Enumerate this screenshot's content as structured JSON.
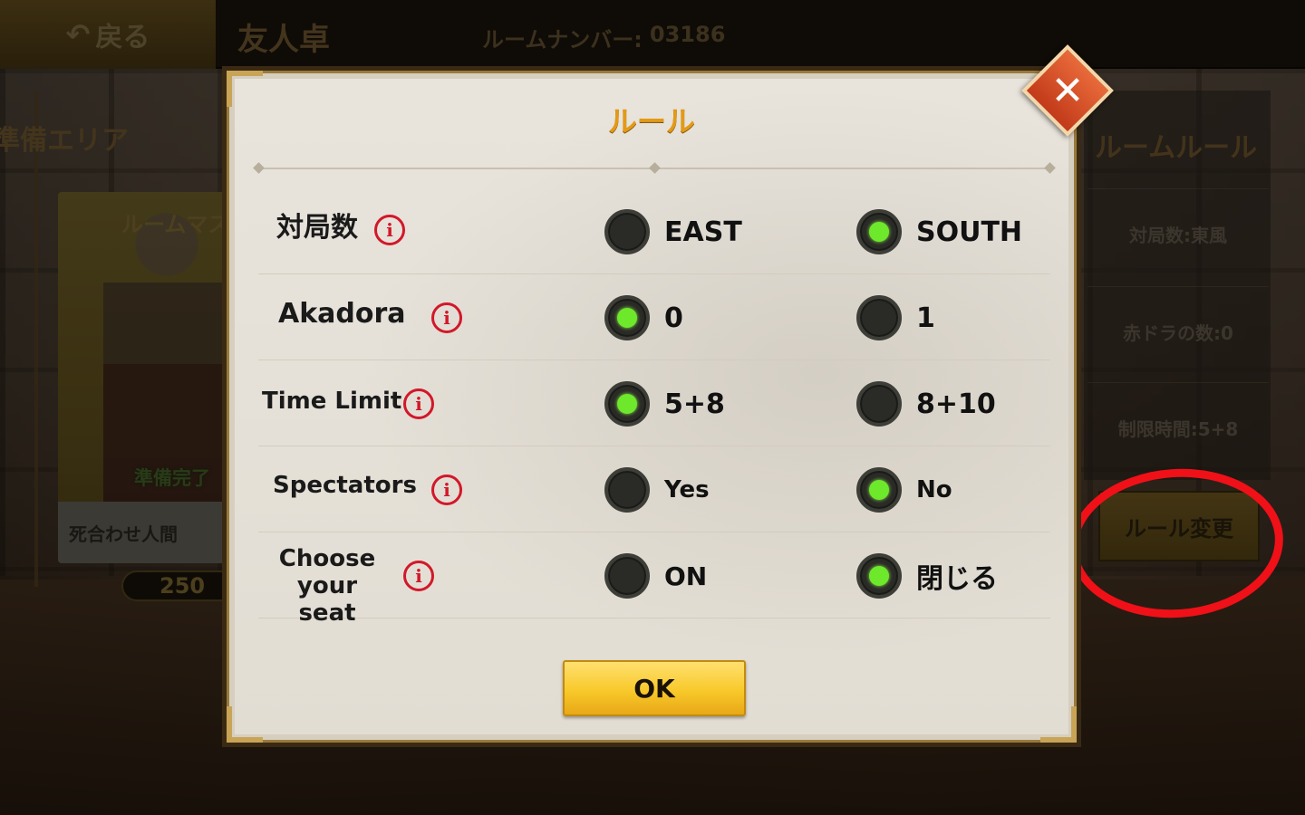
{
  "topbar": {
    "back_label": "戻る",
    "title": "友人卓",
    "room_number_label": "ルームナンバー:",
    "room_number": "03186"
  },
  "left_panel": {
    "area_title": "準備エリア",
    "card_title": "ルームマス",
    "ready_badge": "準備完了",
    "player_name": "死合わせ人間",
    "score": "250"
  },
  "right_panel": {
    "title": "ルームルール",
    "rows": [
      "対局数:東風",
      "赤ドラの数:0",
      "制限時間:5+8"
    ],
    "change_button": "ルール変更"
  },
  "modal": {
    "title": "ルール",
    "close_icon": "close-x-icon",
    "ok_label": "OK",
    "rules": [
      {
        "label": "対局数",
        "options": [
          {
            "label": "EAST",
            "selected": false
          },
          {
            "label": "SOUTH",
            "selected": true
          }
        ]
      },
      {
        "label": "Akadora",
        "options": [
          {
            "label": "0",
            "selected": true
          },
          {
            "label": "1",
            "selected": false
          }
        ]
      },
      {
        "label": "Time Limit",
        "options": [
          {
            "label": "5+8",
            "selected": true
          },
          {
            "label": "8+10",
            "selected": false
          }
        ]
      },
      {
        "label": "Spectators",
        "options": [
          {
            "label": "Yes",
            "selected": false
          },
          {
            "label": "No",
            "selected": true
          }
        ]
      },
      {
        "label_line1": "Choose",
        "label_line2": "your seat",
        "options": [
          {
            "label": "ON",
            "selected": false
          },
          {
            "label": "閉じる",
            "selected": true
          }
        ]
      }
    ]
  },
  "colors": {
    "accent_gold": "#e39a16",
    "radio_selected": "#6ee82a",
    "info_red": "#d2182a",
    "annotation_red": "#f01018",
    "ok_yellow": "#f8c92a"
  }
}
